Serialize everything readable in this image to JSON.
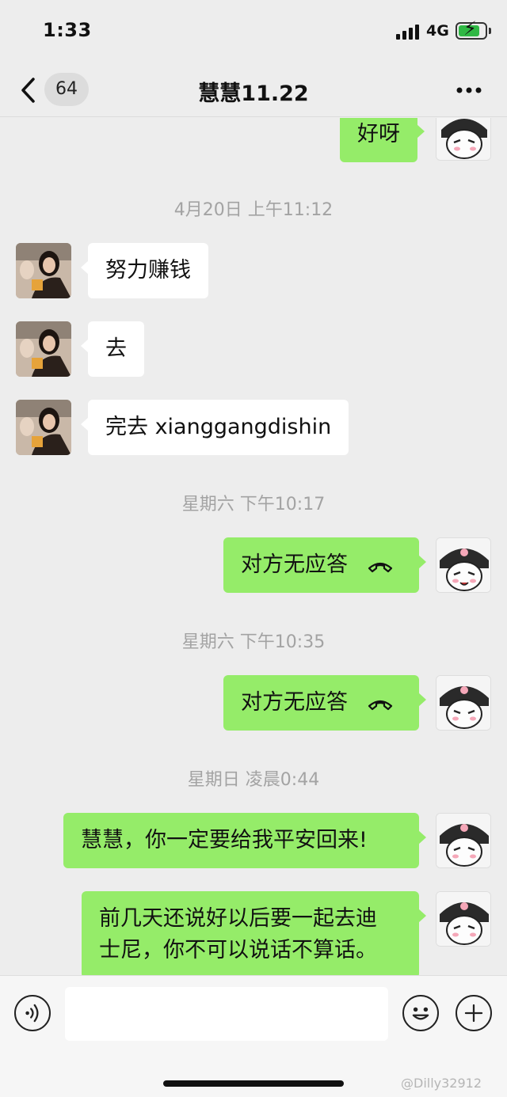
{
  "status_bar": {
    "time": "1:33",
    "network": "4G"
  },
  "nav": {
    "back_count": "64",
    "title": "慧慧11.22"
  },
  "chat": {
    "messages": [
      {
        "side": "right",
        "text": "好呀"
      },
      {
        "timestamp": "4月20日 上午11:12"
      },
      {
        "side": "left",
        "text": "努力赚钱"
      },
      {
        "side": "left",
        "text": "去"
      },
      {
        "side": "left",
        "text": "完去 xianggangdishin"
      },
      {
        "timestamp": "星期六 下午10:17"
      },
      {
        "side": "right",
        "text": "对方无应答",
        "type": "call"
      },
      {
        "timestamp": "星期六 下午10:35"
      },
      {
        "side": "right",
        "text": "对方无应答",
        "type": "call"
      },
      {
        "timestamp": "星期日 凌晨0:44"
      },
      {
        "side": "right",
        "text": "慧慧，你一定要给我平安回来!"
      },
      {
        "side": "right",
        "text_lines": [
          "前几天还说好以后要一起去迪",
          "士尼，你不可以说话不算话。"
        ]
      }
    ]
  },
  "input_bar": {
    "placeholder": ""
  },
  "watermark": "@Dilly32912",
  "colors": {
    "background": "#ededed",
    "bubble_self": "#95ec69",
    "bubble_other": "#ffffff",
    "battery": "#2fb844"
  },
  "icons": [
    "back-chevron-icon",
    "more-icon",
    "voice-icon",
    "emoji-icon",
    "plus-icon",
    "hangup-icon"
  ]
}
